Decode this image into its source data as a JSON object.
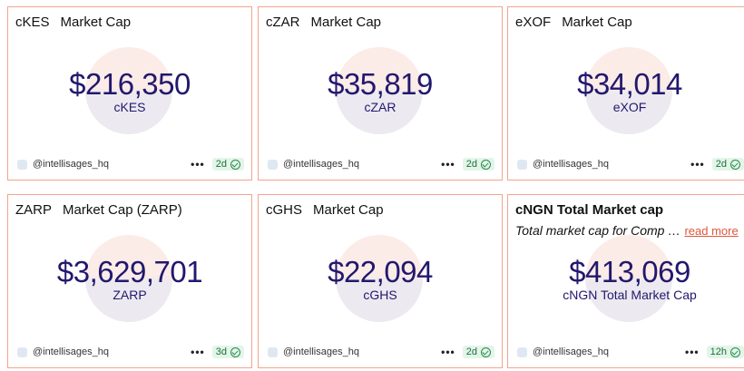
{
  "cards": [
    {
      "symbol": "cKES",
      "label": "Market Cap",
      "value": "$216,350",
      "unit": "cKES",
      "handle": "@intellisages_hq",
      "age": "2d"
    },
    {
      "symbol": "cZAR",
      "label": "Market Cap",
      "value": "$35,819",
      "unit": "cZAR",
      "handle": "@intellisages_hq",
      "age": "2d"
    },
    {
      "symbol": "eXOF",
      "label": "Market Cap",
      "value": "$34,014",
      "unit": "eXOF",
      "handle": "@intellisages_hq",
      "age": "2d"
    },
    {
      "symbol": "ZARP",
      "label": "Market Cap (ZARP)",
      "value": "$3,629,701",
      "unit": "ZARP",
      "handle": "@intellisages_hq",
      "age": "3d"
    },
    {
      "symbol": "cGHS",
      "label": "Market Cap",
      "value": "$22,094",
      "unit": "cGHS",
      "handle": "@intellisages_hq",
      "age": "2d"
    },
    {
      "title": "cNGN Total Market cap",
      "description": "Total market cap for Comp",
      "read_more": "read more",
      "value": "$413,069",
      "unit": "cNGN Total Market Cap",
      "handle": "@intellisages_hq",
      "age": "12h"
    }
  ],
  "icons": {
    "menu": "more-horizontal-icon",
    "verified": "check-circle-icon",
    "avatar": "user-avatar-icon"
  },
  "colors": {
    "border": "#f2a48e",
    "value": "#22186e",
    "badge_bg": "#e3f5e9",
    "badge_text": "#1e6f3c",
    "link": "#e0563b"
  }
}
